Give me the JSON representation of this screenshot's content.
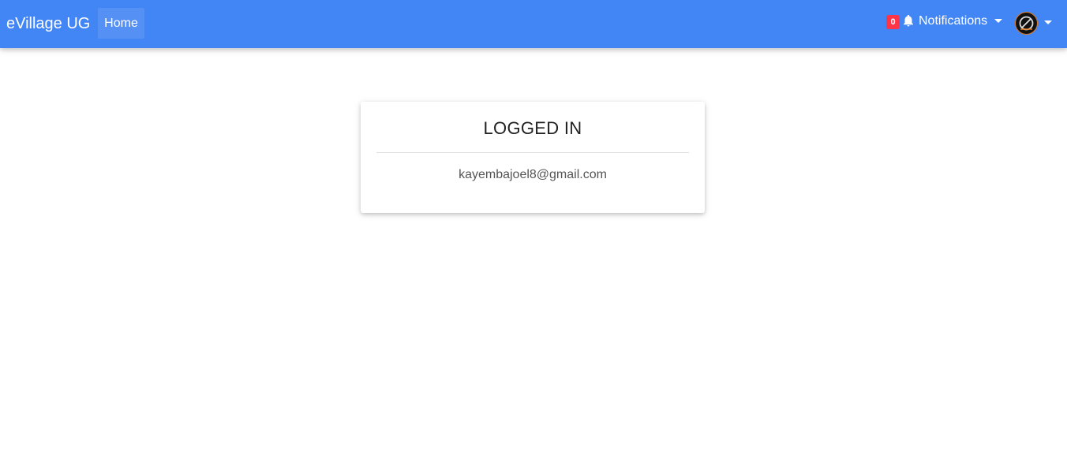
{
  "navbar": {
    "brand": "eVillage UG",
    "home_label": "Home",
    "notifications": {
      "count": "0",
      "label": "Notifications",
      "icon": "bell-icon"
    },
    "user_menu": {
      "avatar_icon": "avatar"
    },
    "accent_color": "#4285f4",
    "badge_color": "#ff3547"
  },
  "card": {
    "title": "LOGGED IN",
    "email": "kayembajoel8@gmail.com"
  }
}
